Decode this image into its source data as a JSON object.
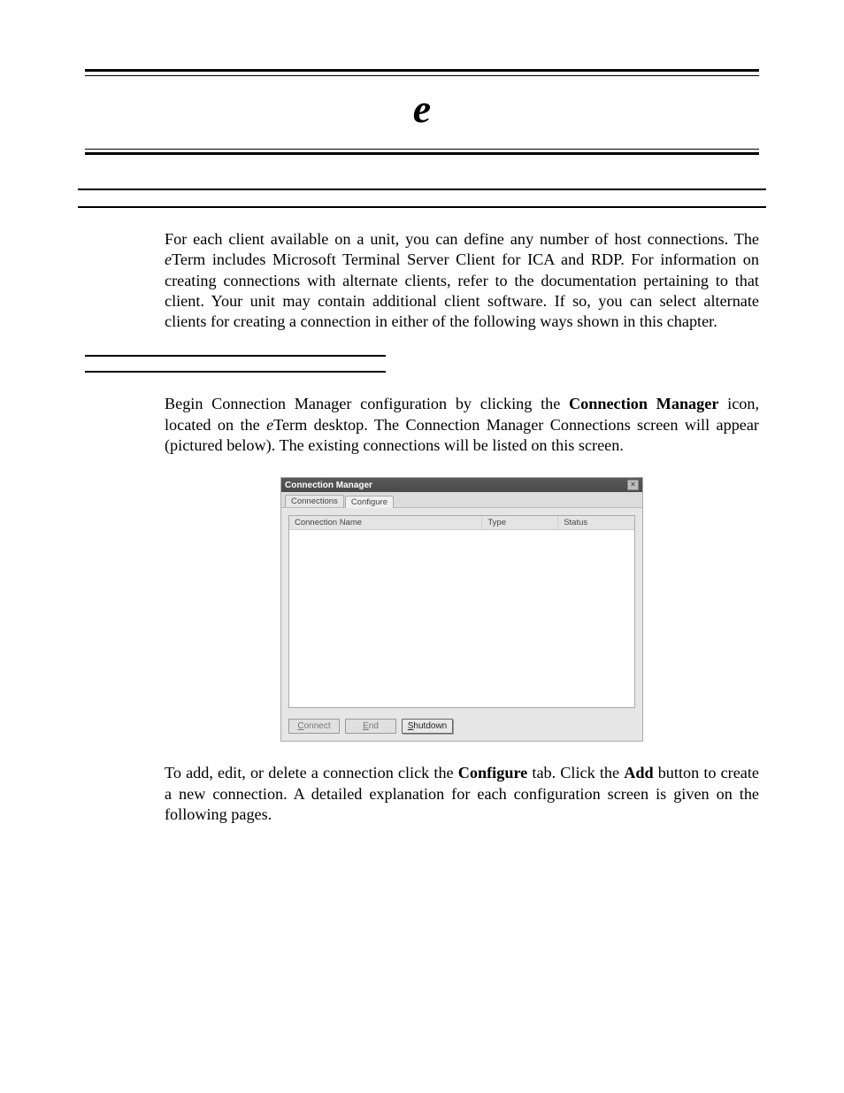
{
  "header": {
    "glyph": "e"
  },
  "paragraphs": {
    "intro_pre": "For each client available on a unit, you can define any number of host connections. The ",
    "intro_em": "e",
    "intro_post": "Term includes Microsoft Terminal Server Client for ICA and RDP. For information on creating connections with alternate clients, refer to the documentation pertaining to that client. Your unit may contain additional client software. If so, you can select alternate clients for creating a connection in either of the following ways shown in this chapter.",
    "begin_pre": "Begin Connection Manager configuration by clicking the ",
    "begin_bold1": "Connection Manager",
    "begin_mid1": " icon, located on the ",
    "begin_em": "e",
    "begin_post1": "Term desktop. The Connection Manager Connections screen will appear (pictured below). The existing connections will be listed on this screen.",
    "addedit_pre": "To add, edit, or delete a connection click the ",
    "addedit_bold1": "Configure",
    "addedit_mid1": " tab.  Click the ",
    "addedit_bold2": "Add",
    "addedit_post": " button to create a new connection. A detailed explanation for each configuration screen is given on the following pages."
  },
  "screenshot": {
    "title": "Connection Manager",
    "close_glyph": "×",
    "tabs": {
      "connections": "Connections",
      "configure": "Configure"
    },
    "columns": {
      "name": "Connection Name",
      "type": "Type",
      "status": "Status"
    },
    "buttons": {
      "connect_u": "C",
      "connect_rest": "onnect",
      "end_u": "E",
      "end_rest": "nd",
      "shutdown_u": "S",
      "shutdown_rest": "hutdown"
    }
  }
}
